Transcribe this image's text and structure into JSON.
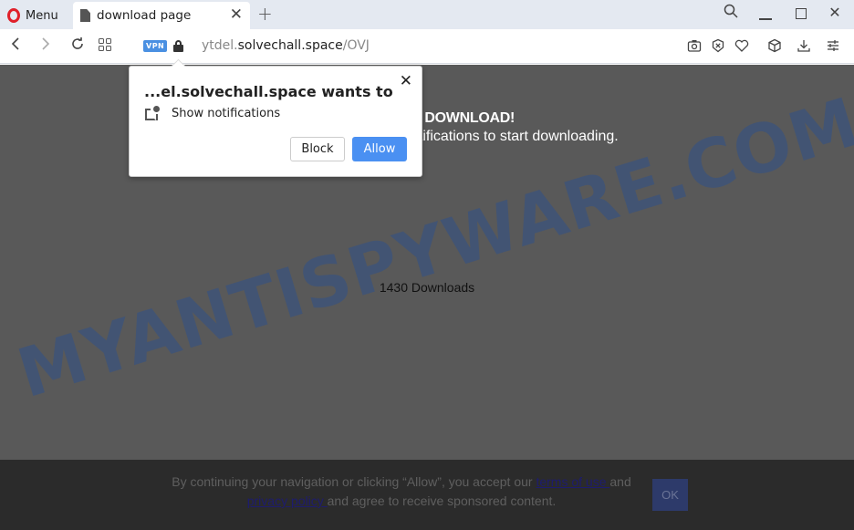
{
  "browser": {
    "menu_label": "Menu",
    "tab": {
      "title": "download page",
      "close_icon": "close-icon"
    },
    "new_tab_icon": "+",
    "window_controls": {
      "search": "search-icon",
      "minimize": "minimize-icon",
      "maximize": "maximize-icon",
      "close": "close-icon"
    },
    "address_bar": {
      "vpn_badge": "VPN",
      "url_prefix": "ytdel.",
      "url_host": "solvechall.space",
      "url_path": "/OVJ"
    },
    "toolbar_icons": [
      "camera-icon",
      "adblock-icon",
      "heart-icon",
      "cube-icon",
      "download-icon",
      "settings-icon"
    ]
  },
  "page": {
    "headline": "D DOWNLOAD!",
    "subline": "otifications to start downloading.",
    "downloads_count": "1430 Downloads",
    "watermark": "MYANTISPYWARE.COM"
  },
  "permission_popup": {
    "title": "...el.solvechall.space wants to",
    "permission": "Show notifications",
    "block_label": "Block",
    "allow_label": "Allow",
    "close_label": "✕"
  },
  "footer": {
    "text_before": "By continuing your navigation or clicking “Allow”, you accept our ",
    "terms_link": "terms of use ",
    "text_middle": "and ",
    "privacy_link": "privacy policy ",
    "text_after": "and agree to receive sponsored content.",
    "ok_label": "OK"
  },
  "colors": {
    "allow_button": "#4a90f2",
    "vpn_badge": "#4a90e2",
    "overlay": "#595959",
    "footer_bg": "#2b2b2b",
    "watermark": "#3f5478"
  }
}
